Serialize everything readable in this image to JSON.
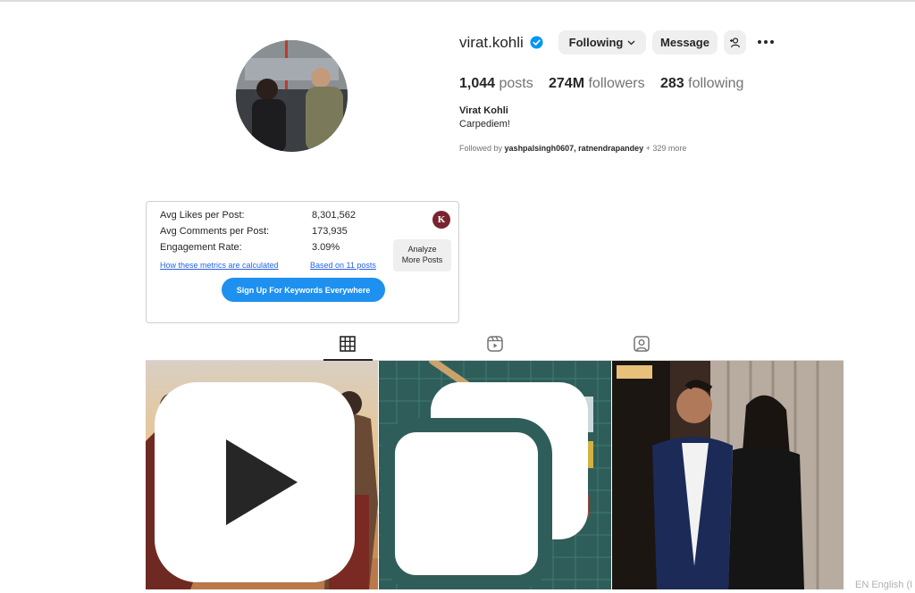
{
  "profile": {
    "username": "virat.kohli",
    "full_name": "Virat Kohli",
    "bio": "Carpediem!",
    "following_button": "Following",
    "message_button": "Message",
    "stats": {
      "posts_count": "1,044",
      "posts_label": "posts",
      "followers_count": "274M",
      "followers_label": "followers",
      "following_count": "283",
      "following_label": "following"
    },
    "followed_by_prefix": "Followed by",
    "followed_by_users": "yashpalsingh0607, ratnendrapandey",
    "followed_by_more": "+ 329 more"
  },
  "metrics": {
    "rows": [
      {
        "label": "Avg Likes per Post:",
        "value": "8,301,562"
      },
      {
        "label": "Avg Comments per Post:",
        "value": "173,935"
      },
      {
        "label": "Engagement Rate:",
        "value": "3.09%"
      }
    ],
    "how_link": "How these metrics are calculated",
    "based_link": "Based on 11 posts",
    "analyze_line1": "Analyze",
    "analyze_line2": "More Posts",
    "signup_button": "Sign Up For Keywords Everywhere",
    "logo_letter": "K"
  },
  "tabs": [
    "posts-grid",
    "reels",
    "tagged"
  ],
  "posts": [
    {
      "badge": "reel-icon"
    },
    {
      "badge": "carousel-icon"
    },
    {
      "badge": ""
    }
  ],
  "footer": {
    "language": "EN English (I"
  },
  "colors": {
    "accent": "#1e90f0",
    "verified": "#0095f6",
    "button_bg": "#efefef"
  }
}
